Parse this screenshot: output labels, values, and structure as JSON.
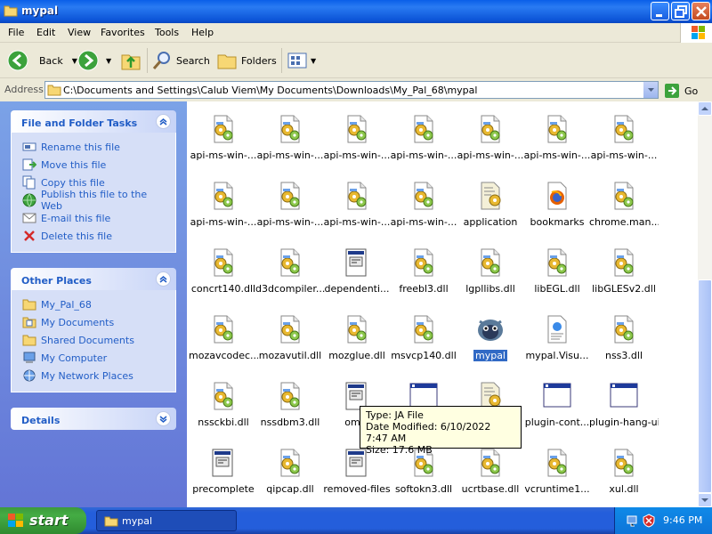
{
  "window": {
    "title": "mypal"
  },
  "menu": [
    "File",
    "Edit",
    "View",
    "Favorites",
    "Tools",
    "Help"
  ],
  "toolbar": {
    "back": "Back",
    "search": "Search",
    "folders": "Folders"
  },
  "address": {
    "label": "Address",
    "path": "C:\\Documents and Settings\\Calub Viem\\My Documents\\Downloads\\My_Pal_68\\mypal",
    "go": "Go"
  },
  "tasks_panel": {
    "title": "File and Folder Tasks",
    "items": [
      "Rename this file",
      "Move this file",
      "Copy this file",
      "Publish this file to the Web",
      "E-mail this file",
      "Delete this file"
    ]
  },
  "places_panel": {
    "title": "Other Places",
    "items": [
      "My_Pal_68",
      "My Documents",
      "Shared Documents",
      "My Computer",
      "My Network Places"
    ]
  },
  "details_panel": {
    "title": "Details"
  },
  "files": [
    {
      "name": "api-ms-win-...",
      "icon": "dll-gear-icon"
    },
    {
      "name": "api-ms-win-...",
      "icon": "dll-gear-icon"
    },
    {
      "name": "api-ms-win-...",
      "icon": "dll-gear-icon"
    },
    {
      "name": "api-ms-win-...",
      "icon": "dll-gear-icon"
    },
    {
      "name": "api-ms-win-...",
      "icon": "dll-gear-icon"
    },
    {
      "name": "api-ms-win-...",
      "icon": "dll-gear-icon"
    },
    {
      "name": "api-ms-win-...",
      "icon": "dll-gear-icon"
    },
    {
      "name": "api-ms-win-...",
      "icon": "dll-gear-icon"
    },
    {
      "name": "api-ms-win-...",
      "icon": "dll-gear-icon"
    },
    {
      "name": "api-ms-win-...",
      "icon": "dll-gear-icon"
    },
    {
      "name": "api-ms-win-...",
      "icon": "dll-gear-icon"
    },
    {
      "name": "application",
      "icon": "config-file-icon"
    },
    {
      "name": "bookmarks",
      "icon": "firefox-icon"
    },
    {
      "name": "chrome.man...",
      "icon": "dll-gear-icon"
    },
    {
      "name": "concrt140.dll",
      "icon": "dll-gear-icon"
    },
    {
      "name": "d3dcompiler...",
      "icon": "dll-gear-icon"
    },
    {
      "name": "dependenti...",
      "icon": "generic-file-icon"
    },
    {
      "name": "freebl3.dll",
      "icon": "dll-gear-icon"
    },
    {
      "name": "lgpllibs.dll",
      "icon": "dll-gear-icon"
    },
    {
      "name": "libEGL.dll",
      "icon": "dll-gear-icon"
    },
    {
      "name": "libGLESv2.dll",
      "icon": "dll-gear-icon"
    },
    {
      "name": "mozavcodec...",
      "icon": "dll-gear-icon"
    },
    {
      "name": "mozavutil.dll",
      "icon": "dll-gear-icon"
    },
    {
      "name": "mozglue.dll",
      "icon": "dll-gear-icon"
    },
    {
      "name": "msvcp140.dll",
      "icon": "dll-gear-icon"
    },
    {
      "name": "mypal",
      "icon": "mypal-app-icon",
      "selected": true
    },
    {
      "name": "mypal.Visu...",
      "icon": "manifest-icon"
    },
    {
      "name": "nss3.dll",
      "icon": "dll-gear-icon"
    },
    {
      "name": "nssckbi.dll",
      "icon": "dll-gear-icon"
    },
    {
      "name": "nssdbm3.dll",
      "icon": "dll-gear-icon"
    },
    {
      "name": "omni",
      "icon": "generic-file-icon"
    },
    {
      "name": "",
      "icon": "window-exe-icon"
    },
    {
      "name": "",
      "icon": "config-file-icon"
    },
    {
      "name": "plugin-cont...",
      "icon": "window-exe-icon"
    },
    {
      "name": "plugin-hang-ui",
      "icon": "window-exe-icon"
    },
    {
      "name": "precomplete",
      "icon": "generic-file-icon"
    },
    {
      "name": "qipcap.dll",
      "icon": "dll-gear-icon"
    },
    {
      "name": "removed-files",
      "icon": "generic-file-icon"
    },
    {
      "name": "softokn3.dll",
      "icon": "dll-gear-icon"
    },
    {
      "name": "ucrtbase.dll",
      "icon": "dll-gear-icon"
    },
    {
      "name": "vcruntime1...",
      "icon": "dll-gear-icon"
    },
    {
      "name": "xul.dll",
      "icon": "dll-gear-icon"
    }
  ],
  "tooltip": {
    "type": "Type: JA File",
    "modified": "Date Modified: 6/10/2022 7:47 AM",
    "size": "Size: 17.6 MB"
  },
  "taskbar": {
    "start": "start",
    "window": "mypal",
    "clock": "9:46 PM"
  },
  "colors": {
    "title_blue": "#0A5FE8",
    "pane_blue": "#7BA2E7",
    "link_blue": "#215DC6",
    "start_green": "#3C9A3C",
    "selection": "#316AC5"
  }
}
